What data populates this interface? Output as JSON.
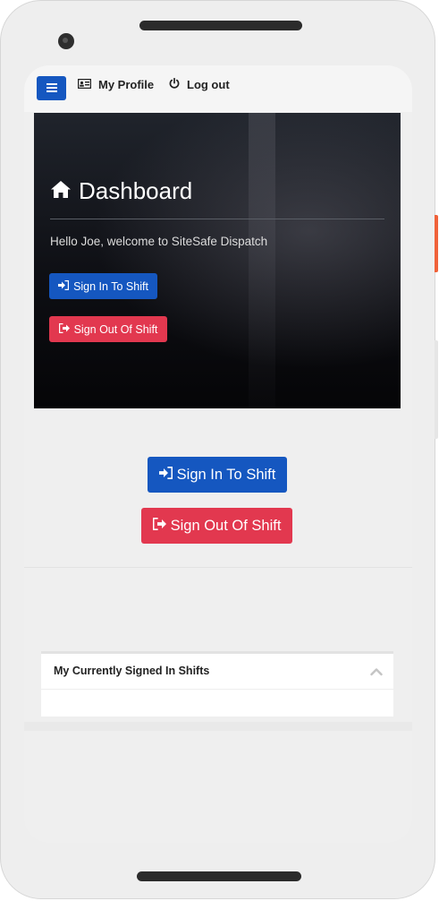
{
  "nav": {
    "menu_icon": "hamburger-icon",
    "profile_label": "My Profile",
    "profile_icon": "id-card-icon",
    "logout_label": "Log out",
    "logout_icon": "power-icon"
  },
  "hero": {
    "title": "Dashboard",
    "title_icon": "home-icon",
    "welcome": "Hello Joe, welcome to SiteSafe Dispatch",
    "sign_in_label": "Sign In To Shift",
    "sign_out_label": "Sign Out Of Shift"
  },
  "actions": {
    "sign_in_label": "Sign In To Shift",
    "sign_out_label": "Sign Out Of Shift"
  },
  "panel": {
    "title": "My Currently Signed In Shifts",
    "toggle_icon": "chevron-up-icon"
  },
  "colors": {
    "primary": "#1557c0",
    "danger": "#e2384f",
    "accent_side_button": "#f0623a"
  }
}
